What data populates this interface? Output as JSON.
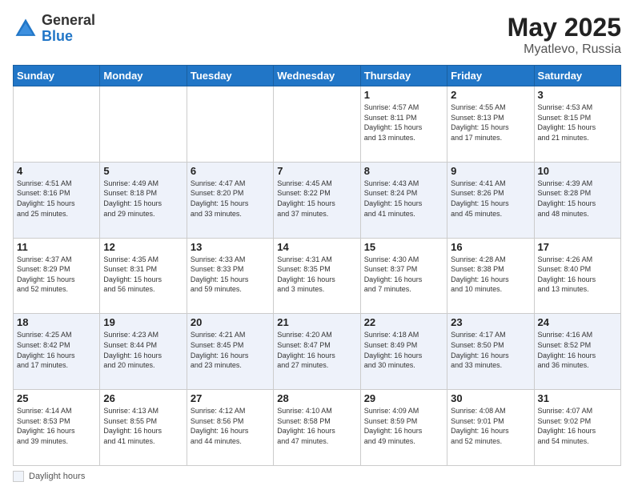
{
  "header": {
    "logo_general": "General",
    "logo_blue": "Blue",
    "title": "May 2025",
    "location": "Myatlevo, Russia"
  },
  "footer": {
    "label": "Daylight hours"
  },
  "weekdays": [
    "Sunday",
    "Monday",
    "Tuesday",
    "Wednesday",
    "Thursday",
    "Friday",
    "Saturday"
  ],
  "weeks": [
    [
      {
        "day": "",
        "info": ""
      },
      {
        "day": "",
        "info": ""
      },
      {
        "day": "",
        "info": ""
      },
      {
        "day": "",
        "info": ""
      },
      {
        "day": "1",
        "info": "Sunrise: 4:57 AM\nSunset: 8:11 PM\nDaylight: 15 hours\nand 13 minutes."
      },
      {
        "day": "2",
        "info": "Sunrise: 4:55 AM\nSunset: 8:13 PM\nDaylight: 15 hours\nand 17 minutes."
      },
      {
        "day": "3",
        "info": "Sunrise: 4:53 AM\nSunset: 8:15 PM\nDaylight: 15 hours\nand 21 minutes."
      }
    ],
    [
      {
        "day": "4",
        "info": "Sunrise: 4:51 AM\nSunset: 8:16 PM\nDaylight: 15 hours\nand 25 minutes."
      },
      {
        "day": "5",
        "info": "Sunrise: 4:49 AM\nSunset: 8:18 PM\nDaylight: 15 hours\nand 29 minutes."
      },
      {
        "day": "6",
        "info": "Sunrise: 4:47 AM\nSunset: 8:20 PM\nDaylight: 15 hours\nand 33 minutes."
      },
      {
        "day": "7",
        "info": "Sunrise: 4:45 AM\nSunset: 8:22 PM\nDaylight: 15 hours\nand 37 minutes."
      },
      {
        "day": "8",
        "info": "Sunrise: 4:43 AM\nSunset: 8:24 PM\nDaylight: 15 hours\nand 41 minutes."
      },
      {
        "day": "9",
        "info": "Sunrise: 4:41 AM\nSunset: 8:26 PM\nDaylight: 15 hours\nand 45 minutes."
      },
      {
        "day": "10",
        "info": "Sunrise: 4:39 AM\nSunset: 8:28 PM\nDaylight: 15 hours\nand 48 minutes."
      }
    ],
    [
      {
        "day": "11",
        "info": "Sunrise: 4:37 AM\nSunset: 8:29 PM\nDaylight: 15 hours\nand 52 minutes."
      },
      {
        "day": "12",
        "info": "Sunrise: 4:35 AM\nSunset: 8:31 PM\nDaylight: 15 hours\nand 56 minutes."
      },
      {
        "day": "13",
        "info": "Sunrise: 4:33 AM\nSunset: 8:33 PM\nDaylight: 15 hours\nand 59 minutes."
      },
      {
        "day": "14",
        "info": "Sunrise: 4:31 AM\nSunset: 8:35 PM\nDaylight: 16 hours\nand 3 minutes."
      },
      {
        "day": "15",
        "info": "Sunrise: 4:30 AM\nSunset: 8:37 PM\nDaylight: 16 hours\nand 7 minutes."
      },
      {
        "day": "16",
        "info": "Sunrise: 4:28 AM\nSunset: 8:38 PM\nDaylight: 16 hours\nand 10 minutes."
      },
      {
        "day": "17",
        "info": "Sunrise: 4:26 AM\nSunset: 8:40 PM\nDaylight: 16 hours\nand 13 minutes."
      }
    ],
    [
      {
        "day": "18",
        "info": "Sunrise: 4:25 AM\nSunset: 8:42 PM\nDaylight: 16 hours\nand 17 minutes."
      },
      {
        "day": "19",
        "info": "Sunrise: 4:23 AM\nSunset: 8:44 PM\nDaylight: 16 hours\nand 20 minutes."
      },
      {
        "day": "20",
        "info": "Sunrise: 4:21 AM\nSunset: 8:45 PM\nDaylight: 16 hours\nand 23 minutes."
      },
      {
        "day": "21",
        "info": "Sunrise: 4:20 AM\nSunset: 8:47 PM\nDaylight: 16 hours\nand 27 minutes."
      },
      {
        "day": "22",
        "info": "Sunrise: 4:18 AM\nSunset: 8:49 PM\nDaylight: 16 hours\nand 30 minutes."
      },
      {
        "day": "23",
        "info": "Sunrise: 4:17 AM\nSunset: 8:50 PM\nDaylight: 16 hours\nand 33 minutes."
      },
      {
        "day": "24",
        "info": "Sunrise: 4:16 AM\nSunset: 8:52 PM\nDaylight: 16 hours\nand 36 minutes."
      }
    ],
    [
      {
        "day": "25",
        "info": "Sunrise: 4:14 AM\nSunset: 8:53 PM\nDaylight: 16 hours\nand 39 minutes."
      },
      {
        "day": "26",
        "info": "Sunrise: 4:13 AM\nSunset: 8:55 PM\nDaylight: 16 hours\nand 41 minutes."
      },
      {
        "day": "27",
        "info": "Sunrise: 4:12 AM\nSunset: 8:56 PM\nDaylight: 16 hours\nand 44 minutes."
      },
      {
        "day": "28",
        "info": "Sunrise: 4:10 AM\nSunset: 8:58 PM\nDaylight: 16 hours\nand 47 minutes."
      },
      {
        "day": "29",
        "info": "Sunrise: 4:09 AM\nSunset: 8:59 PM\nDaylight: 16 hours\nand 49 minutes."
      },
      {
        "day": "30",
        "info": "Sunrise: 4:08 AM\nSunset: 9:01 PM\nDaylight: 16 hours\nand 52 minutes."
      },
      {
        "day": "31",
        "info": "Sunrise: 4:07 AM\nSunset: 9:02 PM\nDaylight: 16 hours\nand 54 minutes."
      }
    ]
  ]
}
